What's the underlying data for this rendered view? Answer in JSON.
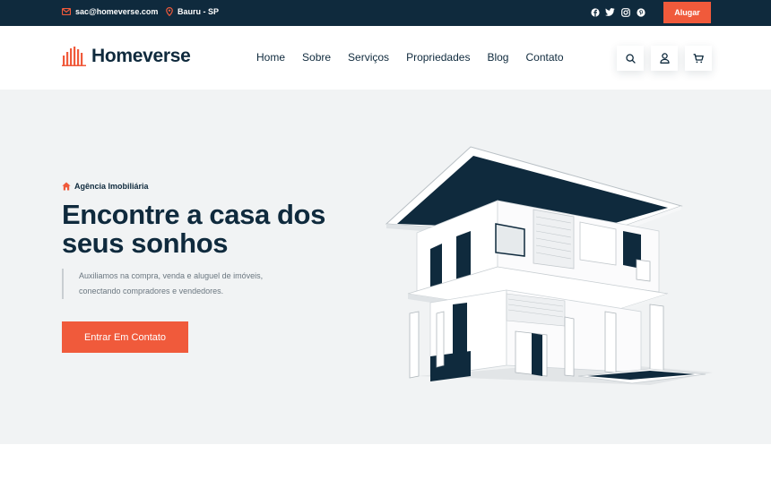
{
  "topbar": {
    "email": "sac@homeverse.com",
    "location": "Bauru - SP",
    "social_icons": [
      "facebook-icon",
      "twitter-icon",
      "instagram-icon",
      "pinterest-icon"
    ],
    "rent_label": "Alugar"
  },
  "header": {
    "brand": "Homeverse",
    "nav": [
      "Home",
      "Sobre",
      "Serviços",
      "Propriedades",
      "Blog",
      "Contato"
    ],
    "action_icons": [
      "search-icon",
      "user-icon",
      "cart-icon"
    ]
  },
  "hero": {
    "subtitle": "Agência Imobiliária",
    "title": "Encontre a casa dos seus sonhos",
    "description": "Auxiliamos na compra, venda e aluguel de imóveis, conectando compradores e vendedores.",
    "cta_label": "Entrar Em Contato"
  },
  "colors": {
    "dark_navy": "#0f2a3d",
    "accent": "#f05a3b",
    "hero_bg": "#f1f3f4"
  }
}
